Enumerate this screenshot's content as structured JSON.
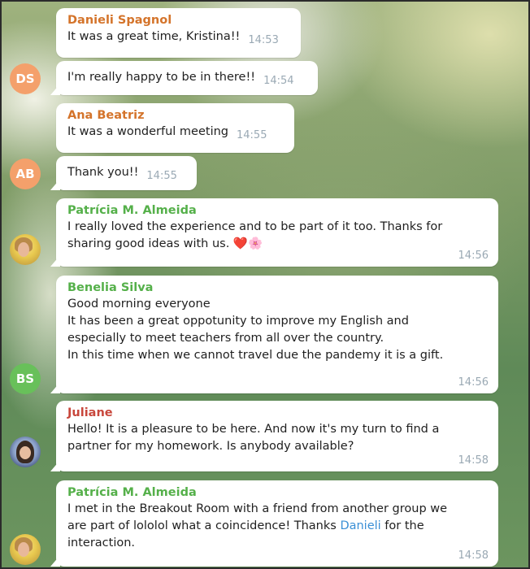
{
  "messages": [
    {
      "sender": "Danieli Spagnol",
      "text": "It was a great time, Kristina!!",
      "time": "14:53"
    },
    {
      "avatar": "DS",
      "text": "I'm really happy to be in there!!",
      "time": "14:54"
    },
    {
      "sender": "Ana Beatriz",
      "text": "It was a wonderful meeting",
      "time": "14:55"
    },
    {
      "avatar": "AB",
      "text": "Thank you!!",
      "time": "14:55"
    },
    {
      "sender": "Patrícia M. Almeida",
      "lines": [
        "I really loved the experience and to be part of it too. Thanks for",
        "sharing good ideas with us."
      ],
      "emoji": [
        "❤️",
        "🌸"
      ],
      "time": "14:56"
    },
    {
      "sender": "Benelia Silva",
      "avatar": "BS",
      "lines": [
        "Good morning everyone",
        "It has been a great oppotunity to improve my English and",
        "especially to meet teachers from all over the country.",
        "In this time when we cannot travel due the pandemy it is a gift."
      ],
      "time": "14:56"
    },
    {
      "sender": "Juliane",
      "lines": [
        "Hello! It is a pleasure to be here. And now it's my turn to find a",
        "partner for my homework. Is anybody available?"
      ],
      "time": "14:58"
    },
    {
      "sender": "Patrícia M. Almeida",
      "lines": [
        "I met in the Breakout Room with a friend from another group we",
        "are part of lololol what a coincidence! Thanks",
        "for the",
        "interaction."
      ],
      "mention": "Danieli",
      "time": "14:58"
    }
  ],
  "colors": {
    "orange_name": "#d4742b",
    "green_name": "#55b04a",
    "red_name": "#c8473c",
    "mention": "#3a8fd6",
    "time": "#9aa9b4"
  }
}
